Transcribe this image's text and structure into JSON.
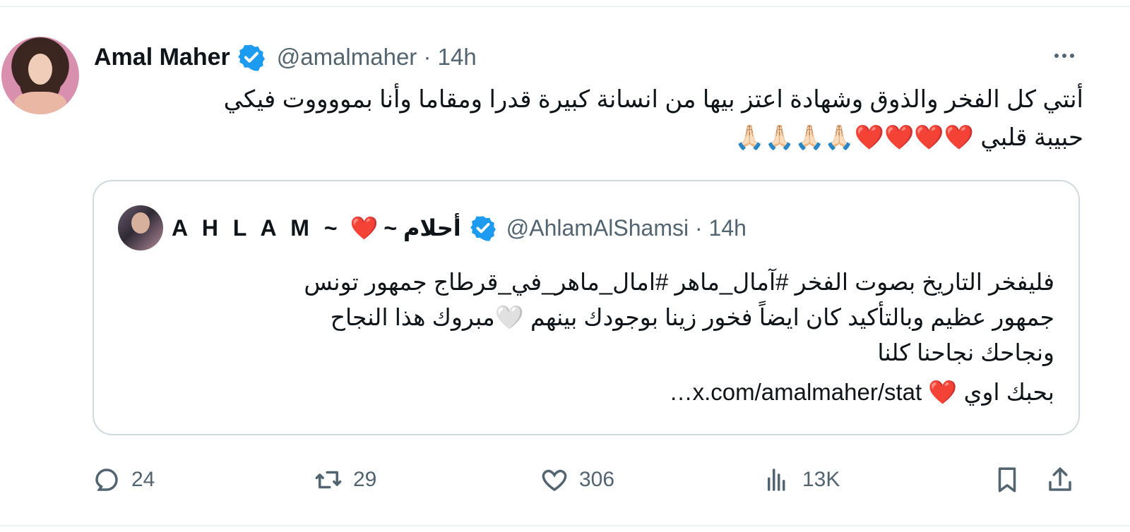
{
  "tweet": {
    "author_name": "Amal Maher",
    "handle_meta": "@amalmaher · 14h",
    "text_line1": "أنتي كل الفخر والذوق وشهادة اعتز بيها من انسانة كبيرة قدرا ومقاما وأنا بمووووت فيكي",
    "text_line2": "حبيبة قلبي ❤️❤️❤️❤️🙏🏻🙏🏻🙏🏻🙏🏻"
  },
  "quote": {
    "name_latin": "A H L A M ~",
    "name_heart": "❤️",
    "name_arabic": "~ أحلام",
    "handle_meta": "@AhlamAlShamsi · 14h",
    "line1": "فليفخر التاريخ بصوت الفخر #آمال_ماهر  #امال_ماهر_في_قرطاج  جمهور تونس",
    "line2": "جمهور عظيم وبالتأكيد كان ايضاً فخور زينا بوجودك بينهم 🤍مبروك هذا النجاح",
    "line3": "ونجاحك نجاحنا كلنا",
    "line4": "بحبك اوي ❤️ x.com/amalmaher/stat…"
  },
  "actions": {
    "replies": "24",
    "retweets": "29",
    "likes": "306",
    "views": "13K"
  },
  "colors": {
    "verified_blue": "#1d9bf0",
    "secondary_text": "#536471",
    "border": "#cfd9de"
  }
}
